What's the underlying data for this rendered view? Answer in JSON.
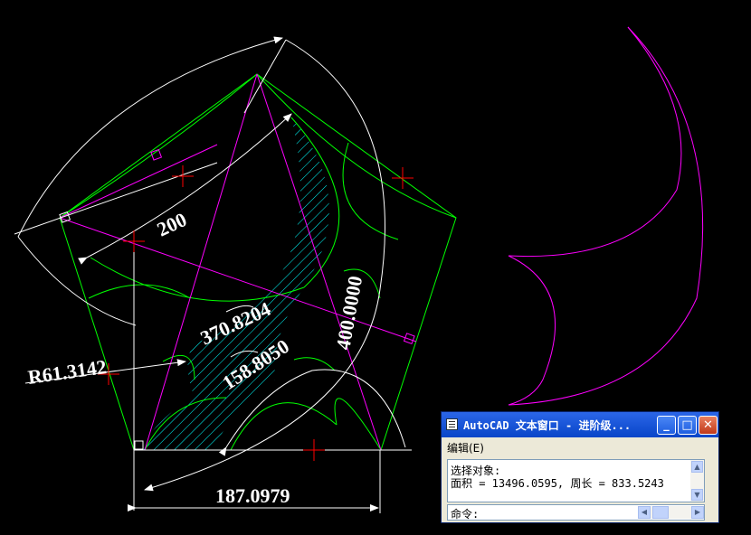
{
  "drawing": {
    "dimensions": {
      "d200": "200",
      "d370": "370.8204",
      "d158": "158.8050",
      "d400": "400.0000",
      "radius": "R61.3142",
      "d187": "187.0979"
    },
    "colors": {
      "background": "#000000",
      "geometry": "#00ff00",
      "construction": "#ff00ff",
      "dimension": "#ffffff",
      "hatch": "#00ffff",
      "marker": "#ff0000"
    }
  },
  "text_window": {
    "title": "AutoCAD 文本窗口 - 进阶级...",
    "menu_edit": "编辑(E)",
    "history": [
      "选择对象:",
      "面积 = 13496.0595, 周长 = 833.5243"
    ],
    "command_label": "命令:",
    "buttons": {
      "minimize": "_",
      "maximize": "□",
      "close": "✕"
    }
  }
}
